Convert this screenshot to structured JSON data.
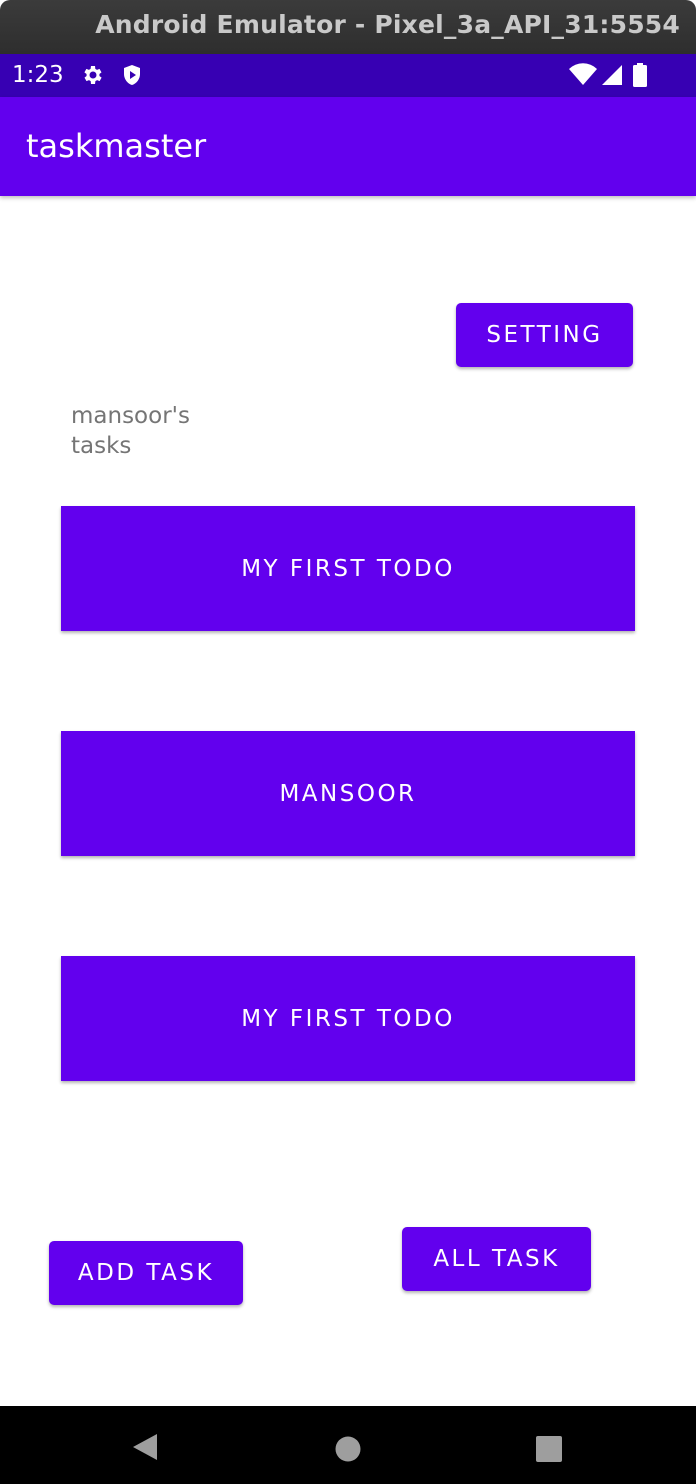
{
  "window": {
    "title": "Android Emulator - Pixel_3a_API_31:5554"
  },
  "status_bar": {
    "time": "1:23"
  },
  "app_bar": {
    "title": "taskmaster"
  },
  "main": {
    "setting_label": "Setting",
    "tasks_heading": "mansoor's tasks",
    "task_buttons": [
      {
        "label": "My First Todo"
      },
      {
        "label": "Mansoor"
      },
      {
        "label": "My First Todo"
      }
    ],
    "add_task_label": "Add Task",
    "all_task_label": "All Task"
  },
  "colors": {
    "primary": "#6200ee",
    "status_bar": "#3700b3",
    "text_secondary": "#757575"
  }
}
